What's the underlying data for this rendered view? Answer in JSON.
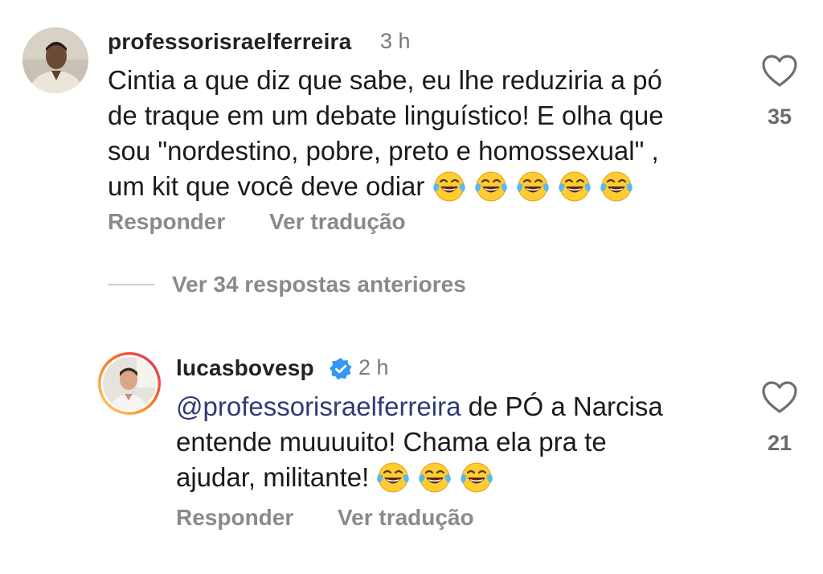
{
  "comment1": {
    "username": "professorisraelferreira",
    "time": "3 h",
    "text": "Cintia a que diz que sabe, eu lhe reduziria a pó de traque em um debate linguístico! E olha que sou \"nordestino, pobre, preto e homossexual\" , um kit que você deve odiar",
    "line1": "Cintia a que diz que sabe, eu lhe reduziria a pó",
    "line2": "de traque em um debate linguístico! E olha que",
    "line3": "sou \"nordestino, pobre, preto e homossexual\" ,",
    "line4": "um kit que você deve odiar",
    "emoji_count": 5,
    "likes": "35",
    "reply_label": "Responder",
    "translate_label": "Ver tradução"
  },
  "view_replies": {
    "label": "Ver 34 respostas anteriores"
  },
  "comment2": {
    "username": "lucasbovesp",
    "time": "2 h",
    "mention": "@professorisraelferreira",
    "line1_rest": " de PÓ a Narcisa",
    "line2": "entende muuuuito! Chama ela pra te",
    "line3": "ajudar, militante!",
    "emoji_count": 3,
    "likes": "21",
    "reply_label": "Responder",
    "translate_label": "Ver tradução"
  },
  "icons": {
    "like": "heart-outline-icon",
    "verified": "verified-badge-icon",
    "emoji": "face-with-tears-of-joy-emoji"
  },
  "colors": {
    "mention": "#2e3b73",
    "verified": "#3897f0",
    "muted": "#8a8a8a",
    "story_ring_start": "#feda75",
    "story_ring_end": "#d62976"
  }
}
